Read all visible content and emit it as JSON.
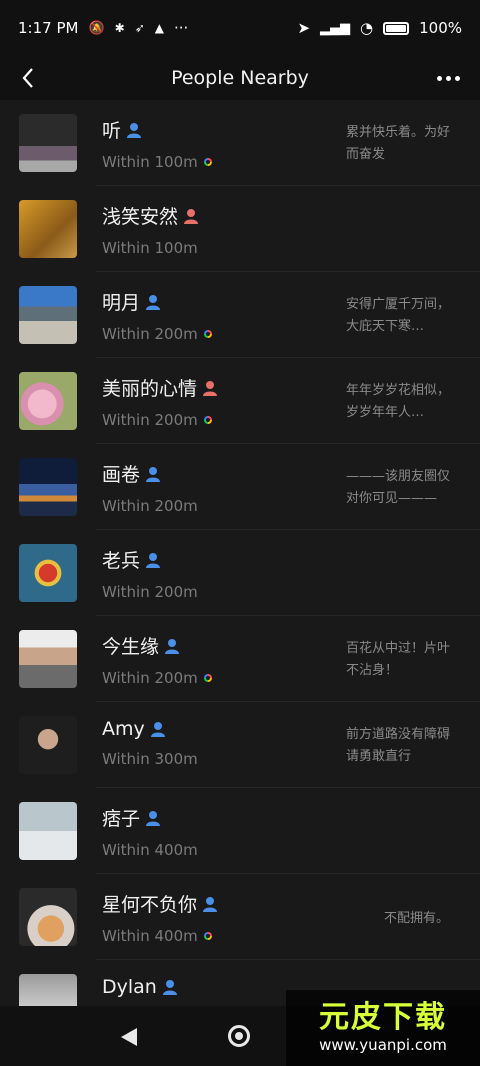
{
  "status_bar": {
    "time": "1:17 PM",
    "battery": "100%"
  },
  "header": {
    "title": "People Nearby"
  },
  "people": [
    {
      "name": "听",
      "gender": "male",
      "distance": "Within 100m",
      "ring": true,
      "signature": "累并快乐着。为好而奋发"
    },
    {
      "name": "浅笑安然",
      "gender": "female",
      "distance": "Within 100m",
      "ring": false,
      "signature": ""
    },
    {
      "name": "明月",
      "gender": "male",
      "distance": "Within 200m",
      "ring": true,
      "signature": "安得广厦千万间，大庇天下寒…"
    },
    {
      "name": "美丽的心情",
      "gender": "female",
      "distance": "Within 200m",
      "ring": true,
      "signature": "年年岁岁花相似，岁岁年年人…"
    },
    {
      "name": "画卷",
      "gender": "male",
      "distance": "Within 200m",
      "ring": false,
      "signature": "———该朋友圈仅对你可见———"
    },
    {
      "name": "老兵",
      "gender": "male",
      "distance": "Within 200m",
      "ring": false,
      "signature": ""
    },
    {
      "name": "今生缘",
      "gender": "male",
      "distance": "Within 200m",
      "ring": true,
      "signature": "百花从中过！片叶不沾身！"
    },
    {
      "name": "Amy",
      "gender": "male",
      "distance": "Within 300m",
      "ring": false,
      "signature": "前方道路没有障碍请勇敢直行"
    },
    {
      "name": "痞子",
      "gender": "male",
      "distance": "Within 400m",
      "ring": false,
      "signature": ""
    },
    {
      "name": "星何不负你",
      "gender": "male",
      "distance": "Within 400m",
      "ring": true,
      "signature": "不配拥有。"
    },
    {
      "name": "Dylan",
      "gender": "male",
      "distance": "",
      "ring": false,
      "signature": ""
    }
  ],
  "watermark": {
    "title": "元皮下载",
    "url": "www.yuanpi.com"
  },
  "colors": {
    "male": "#4a8fe8",
    "female": "#e8706a",
    "background": "#191919",
    "watermark_title": "#d7ff3a"
  }
}
